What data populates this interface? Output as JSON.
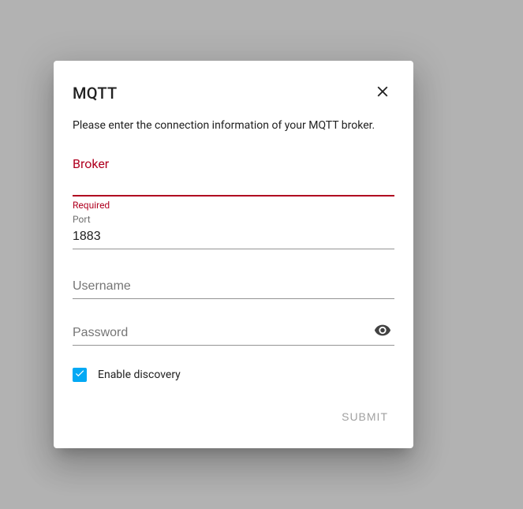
{
  "dialog": {
    "title": "MQTT",
    "description": "Please enter the connection information of your MQTT broker.",
    "fields": {
      "broker": {
        "label": "Broker",
        "value": "",
        "error": "Required"
      },
      "port": {
        "label": "Port",
        "value": "1883"
      },
      "username": {
        "label": "Username",
        "value": ""
      },
      "password": {
        "label": "Password",
        "value": ""
      }
    },
    "checkbox": {
      "label": "Enable discovery",
      "checked": true
    },
    "submit_label": "SUBMIT"
  }
}
